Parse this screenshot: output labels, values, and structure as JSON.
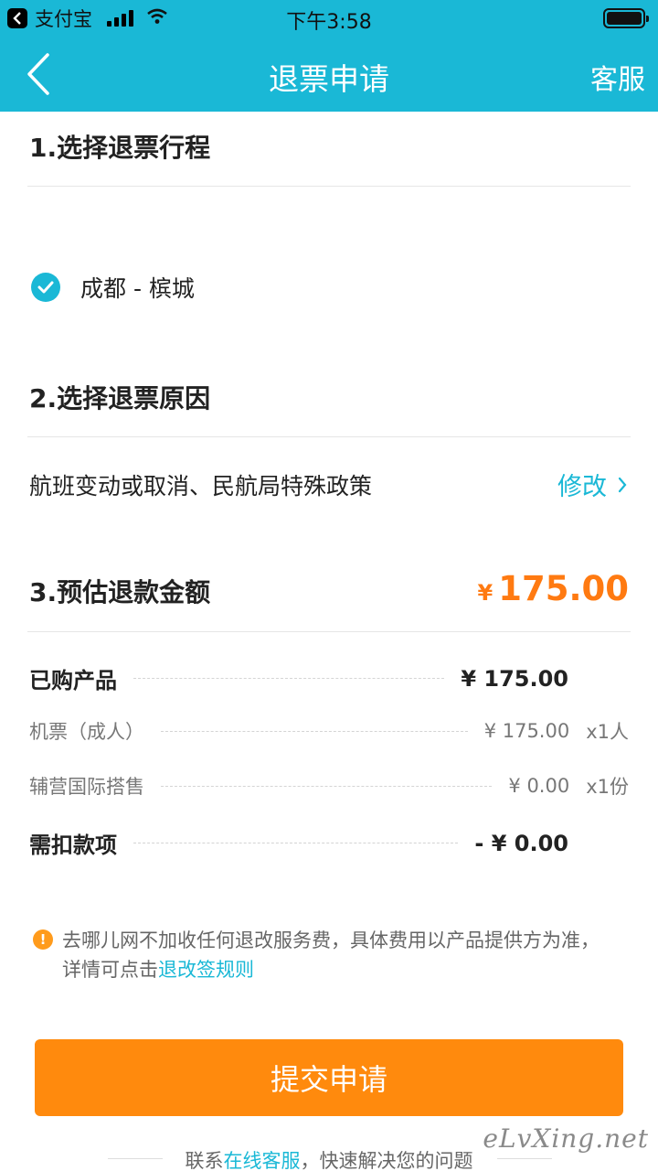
{
  "status_bar": {
    "app_name": "支付宝",
    "time": "下午3:58"
  },
  "nav": {
    "title": "退票申请",
    "service_label": "客服"
  },
  "section1": {
    "title": "1.选择退票行程",
    "trip": "成都 - 槟城"
  },
  "section2": {
    "title": "2.选择退票原因",
    "reason": "航班变动或取消、民航局特殊政策",
    "modify_label": "修改"
  },
  "section3": {
    "title": "3.预估退款金额",
    "currency": "¥",
    "total": "175.00",
    "rows": [
      {
        "label": "已购产品",
        "value": "¥ 175.00",
        "qty": ""
      },
      {
        "label": "机票（成人）",
        "value": "¥ 175.00",
        "qty": "x1人"
      },
      {
        "label": "辅营国际搭售",
        "value": "¥ 0.00",
        "qty": "x1份"
      },
      {
        "label": "需扣款项",
        "value": "- ¥ 0.00",
        "qty": ""
      }
    ]
  },
  "notice": {
    "text": "去哪儿网不加收任何退改服务费，具体费用以产品提供方为准，详情可点击",
    "link": "退改签规则"
  },
  "submit_label": "提交申请",
  "footer": {
    "prefix": "联系",
    "link": "在线客服",
    "suffix": "，快速解决您的问题"
  },
  "watermark": "eLvXing.net",
  "colors": {
    "header": "#1ab8d6",
    "accent": "#ff8a0d",
    "price": "#ff7a11",
    "link": "#1ab8d6"
  }
}
